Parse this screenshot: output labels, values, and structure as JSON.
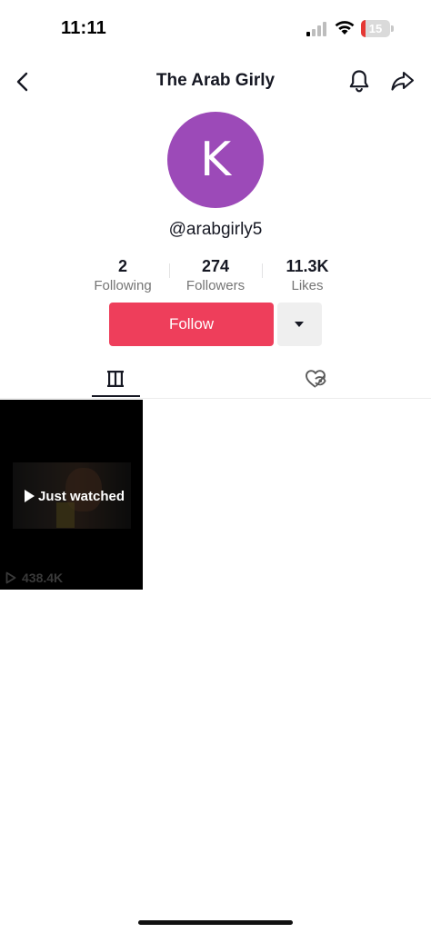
{
  "status_bar": {
    "time": "11:11",
    "battery_level": "15",
    "signal_icon": "cellular-signal-icon",
    "wifi_icon": "wifi-icon",
    "battery_icon": "battery-icon",
    "battery_color": "#e53935"
  },
  "header": {
    "title": "The Arab Girly",
    "back_icon": "chevron-left-icon",
    "bell_icon": "bell-icon",
    "share_icon": "share-arrow-icon"
  },
  "profile": {
    "avatar_letter": "K",
    "avatar_color": "#9c4ab8",
    "username": "@arabgirly5"
  },
  "stats": {
    "following": {
      "value": "2",
      "label": "Following"
    },
    "followers": {
      "value": "274",
      "label": "Followers"
    },
    "likes": {
      "value": "11.3K",
      "label": "Likes"
    }
  },
  "actions": {
    "follow_label": "Follow",
    "follow_color": "#ee3e5b",
    "dropdown_icon": "caret-down-icon"
  },
  "tabs": [
    {
      "name": "videos",
      "icon": "video-grid-icon",
      "active": true
    },
    {
      "name": "liked",
      "icon": "hidden-liked-icon",
      "active": false
    }
  ],
  "videos": [
    {
      "overlay": "Just watched",
      "views": "438.4K",
      "play_icon": "play-icon"
    }
  ]
}
